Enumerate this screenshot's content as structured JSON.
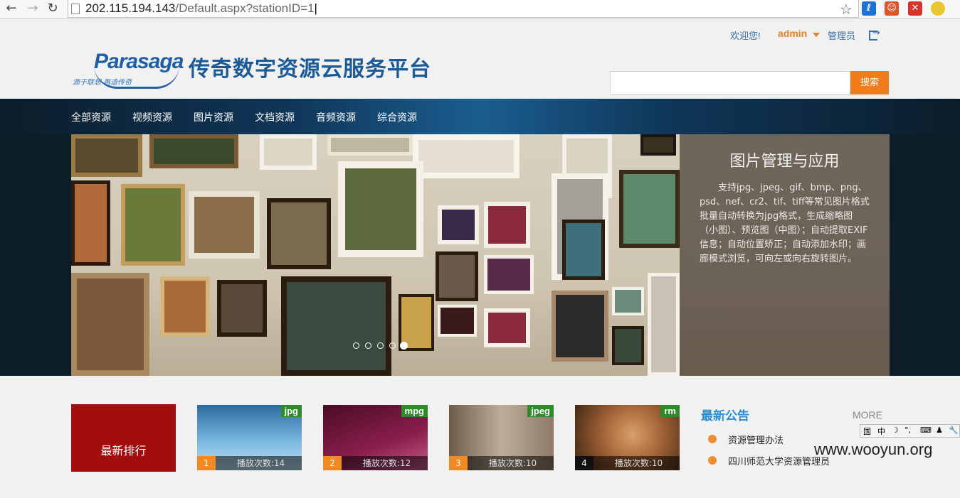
{
  "browser": {
    "url_host": "202.115.194.143",
    "url_path": "/Default.aspx?stationID=1",
    "back_icon": "arrow-left",
    "forward_icon": "arrow-right",
    "reload_icon": "reload",
    "bookmark_icon": "star",
    "extensions": [
      {
        "name": "ext-blue",
        "color": "#1c72d6",
        "glyph": "ℓ"
      },
      {
        "name": "ext-orange",
        "color": "#e0542a",
        "glyph": "☺"
      },
      {
        "name": "ext-red",
        "color": "#d9342b",
        "glyph": "✕"
      },
      {
        "name": "ext-yellow",
        "color": "#e7c631",
        "glyph": "●"
      }
    ]
  },
  "header": {
    "welcome": "欢迎您!",
    "username": "admin",
    "role": "管理员",
    "logo_text": "Parasaga",
    "logo_sub": "源于联想 再造传奇",
    "site_title": "传奇数字资源云服务平台",
    "search_placeholder": "",
    "search_button": "搜索"
  },
  "nav": [
    "全部资源",
    "视频资源",
    "图片资源",
    "文档资源",
    "音频资源",
    "综合资源"
  ],
  "banner": {
    "title": "图片管理与应用",
    "text": "支持jpg、jpeg、gif、bmp、png、psd、nef、cr2、tif、tiff等常见图片格式批量自动转换为jpg格式，生成缩略图（小图）、预览图（中图）；自动提取EXIF信息；自动位置矫正；自动添加水印；画廊模式浏览，可向左或向右旋转图片。",
    "slide_count": 5,
    "active_slide": 5
  },
  "ranking": {
    "label": "最新排行",
    "items": [
      {
        "rank": "1",
        "format": "jpg",
        "plays": "播放次数:14",
        "colors": [
          "#2a6c9e",
          "#79b7df",
          "#bfe3f2"
        ]
      },
      {
        "rank": "2",
        "format": "mpg",
        "plays": "播放次数:12",
        "colors": [
          "#4a0c24",
          "#8a1f4c",
          "#c85e8e"
        ]
      },
      {
        "rank": "3",
        "format": "jpeg",
        "plays": "播放次数:10",
        "colors": [
          "#8e7a66",
          "#bcae9a",
          "#6e5c4a"
        ]
      },
      {
        "rank": "4",
        "format": "rm",
        "plays": "播放次数:10",
        "colors": [
          "#3a2410",
          "#a06236",
          "#d9a06a"
        ]
      }
    ]
  },
  "notices": {
    "title": "最新公告",
    "more": "MORE",
    "items": [
      "资源管理办法",
      "四川师范大学资源管理员"
    ]
  },
  "ime_bar": [
    "国",
    "中",
    "☽",
    "°,",
    "⌨",
    "♟",
    "🔧"
  ],
  "watermark": "www.wooyun.org",
  "colors": {
    "accent_orange": "#f37c1a",
    "link_blue": "#3a6ea5",
    "title_blue": "#1c5a96",
    "rank_red": "#a20d0d"
  }
}
